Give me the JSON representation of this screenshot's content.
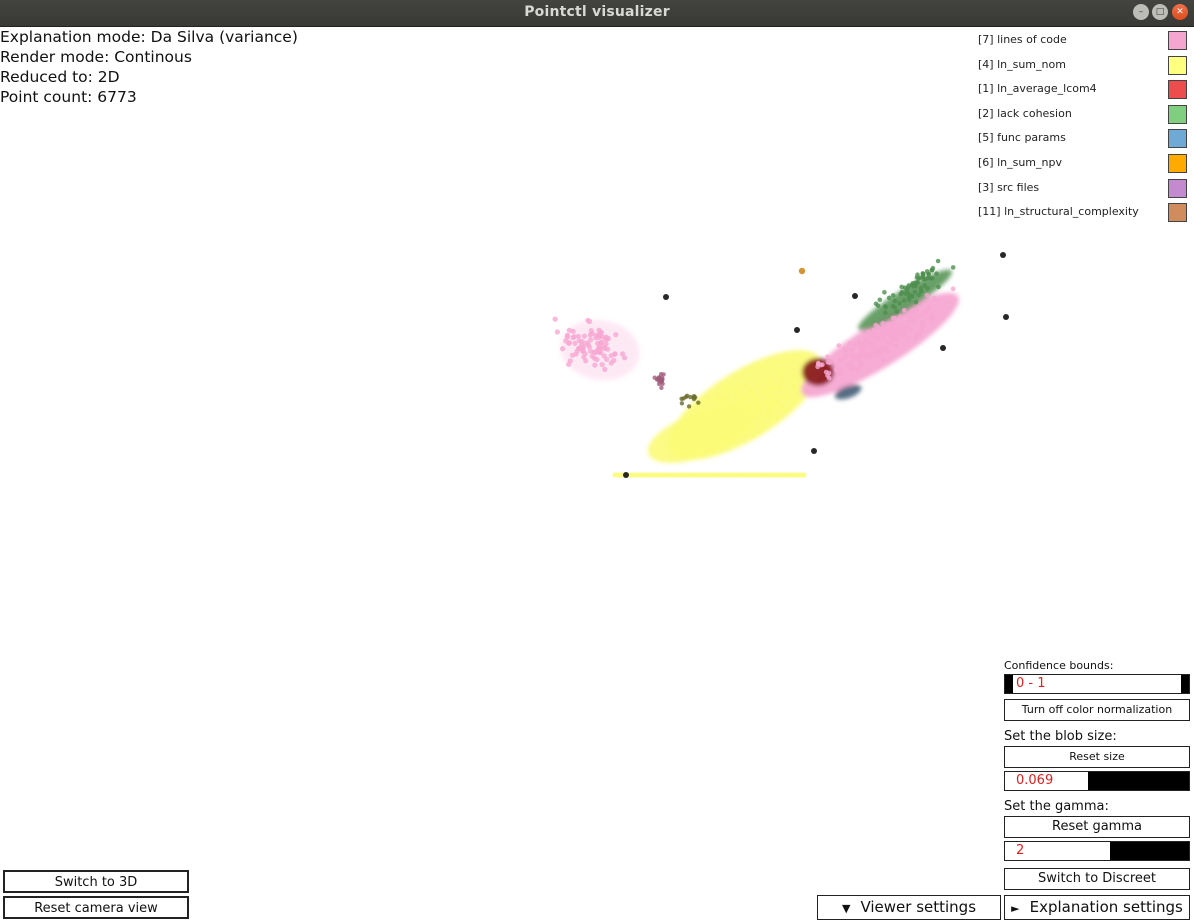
{
  "window": {
    "title": "Pointctl visualizer"
  },
  "info": {
    "explanation_mode": "Explanation mode: Da Silva (variance)",
    "render_mode": "Render mode: Continous",
    "reduced_to": "Reduced to: 2D",
    "point_count": "Point count: 6773"
  },
  "legend": [
    {
      "label": "[7] lines of code",
      "color": "#f4a6d0"
    },
    {
      "label": "[4] ln_sum_nom",
      "color": "#ffff80"
    },
    {
      "label": "[1] ln_average_lcom4",
      "color": "#ee4d4d"
    },
    {
      "label": "[2] lack cohesion",
      "color": "#80cf80"
    },
    {
      "label": "[5] func params",
      "color": "#6faad6"
    },
    {
      "label": "[6] ln_sum_npv",
      "color": "#ffaa00"
    },
    {
      "label": "[3] src files",
      "color": "#c48ad0"
    },
    {
      "label": "[11] ln_structural_complexity",
      "color": "#d08c5c"
    }
  ],
  "controls": {
    "confidence_label": "Confidence bounds:",
    "confidence_value": "0 - 1",
    "color_norm_button": "Turn off color normalization",
    "blob_label": "Set the blob size:",
    "reset_size_button": "Reset size",
    "blob_value": "0.069",
    "blob_fraction": 0.45,
    "gamma_label": "Set the gamma:",
    "reset_gamma_button": "Reset gamma",
    "gamma_value": "2",
    "gamma_fraction": 0.57,
    "switch_discreet_button": "Switch to Discreet",
    "switch_3d_button": "Switch to 3D",
    "reset_camera_button": "Reset camera view",
    "viewer_settings_button": "Viewer settings",
    "explanation_settings_button": "Explanation settings"
  },
  "plot": {
    "point_colors": {
      "pink": "#f6a8d2",
      "yellow": "#fbfb78",
      "darkred": "#8a1e1e",
      "green": "#4f8f4f",
      "navy": "#2b4a66",
      "black": "#111111",
      "orange": "#d08a20",
      "mauve": "#a05a7a",
      "olive": "#6b6b2a"
    }
  }
}
